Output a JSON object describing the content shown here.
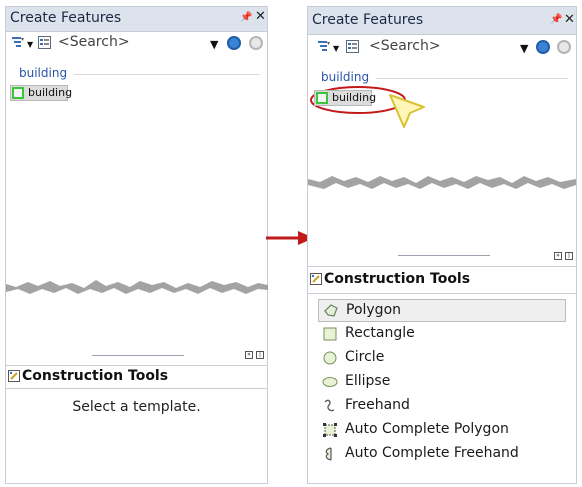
{
  "colors": {
    "accent_arrow": "#c21a1a",
    "template_border": "#3cc43c",
    "group_text": "#2a55a8"
  },
  "left_panel": {
    "title": "Create Features",
    "pin_glyph": "ᵖ",
    "close_glyph": "✕",
    "search_placeholder": "<Search>",
    "group_name": "building",
    "template_label": "building",
    "construction_title": "Construction Tools",
    "construction_message": "Select a template."
  },
  "right_panel": {
    "title": "Create Features",
    "pin_glyph": "ᵖ",
    "close_glyph": "✕",
    "search_placeholder": "<Search>",
    "group_name": "building",
    "template_label": "building",
    "construction_title": "Construction Tools",
    "tools": [
      {
        "label": "Polygon",
        "icon": "polygon-icon",
        "selected": true
      },
      {
        "label": "Rectangle",
        "icon": "rectangle-icon",
        "selected": false
      },
      {
        "label": "Circle",
        "icon": "circle-icon",
        "selected": false
      },
      {
        "label": "Ellipse",
        "icon": "ellipse-icon",
        "selected": false
      },
      {
        "label": "Freehand",
        "icon": "freehand-icon",
        "selected": false
      },
      {
        "label": "Auto Complete Polygon",
        "icon": "auto-complete-polygon-icon",
        "selected": false
      },
      {
        "label": "Auto Complete Freehand",
        "icon": "auto-complete-freehand-icon",
        "selected": false
      }
    ]
  }
}
